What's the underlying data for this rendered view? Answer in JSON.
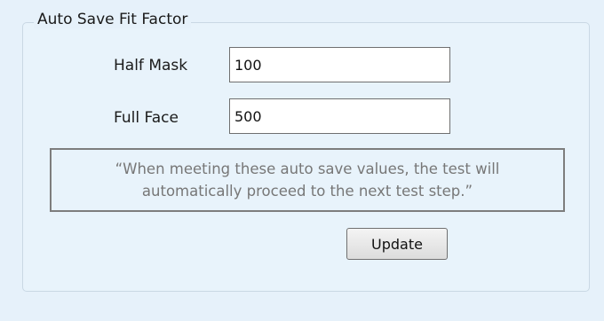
{
  "group": {
    "title": "Auto Save Fit Factor"
  },
  "fields": {
    "half_mask": {
      "label": "Half Mask",
      "value": "100"
    },
    "full_face": {
      "label": "Full Face",
      "value": "500"
    }
  },
  "note": {
    "line1": "“When meeting these auto save values, the test will",
    "line2": "automatically proceed to the next test step.”"
  },
  "update_button": {
    "label": "Update"
  }
}
